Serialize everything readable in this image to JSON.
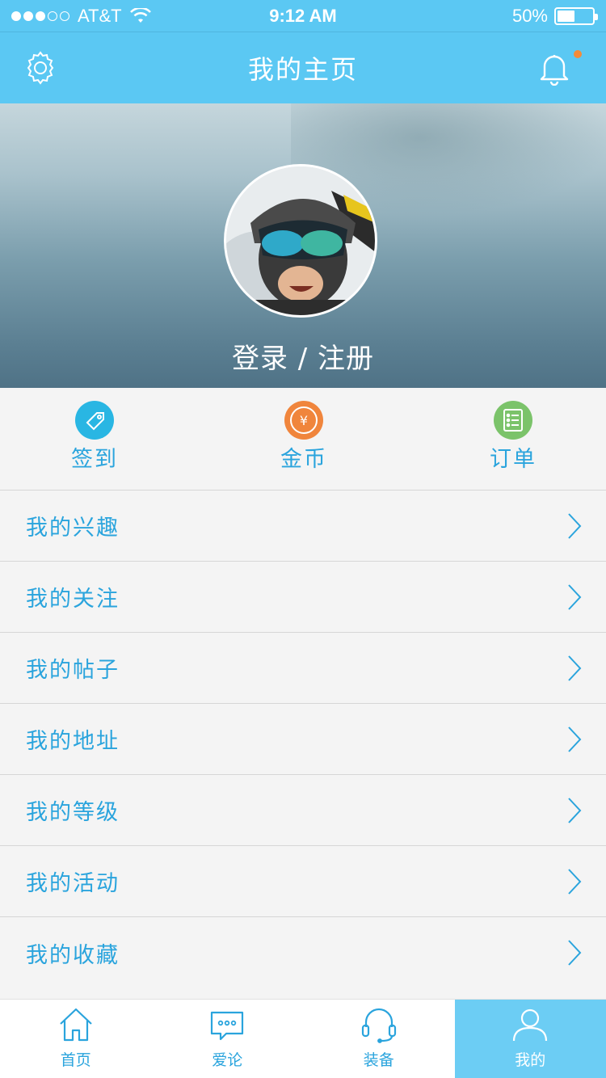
{
  "status_bar": {
    "carrier": "AT&T",
    "time": "9:12 AM",
    "battery_text": "50%",
    "battery_level": 0.5,
    "signal_bars_filled": 3,
    "signal_bars_total": 5
  },
  "nav": {
    "title": "我的主页",
    "settings_icon": "gear-icon",
    "bell_icon": "bell-icon",
    "has_notification": true
  },
  "profile": {
    "login_label": "登录 / 注册",
    "avatar_icon": "avatar"
  },
  "quick_actions": [
    {
      "label": "签到",
      "icon": "tag-icon",
      "color": "#29b6e3"
    },
    {
      "label": "金币",
      "icon": "coin-icon",
      "color": "#f0853c"
    },
    {
      "label": "订单",
      "icon": "list-icon",
      "color": "#7bc36a"
    }
  ],
  "menu": [
    {
      "label": "我的兴趣"
    },
    {
      "label": "我的关注"
    },
    {
      "label": "我的帖子"
    },
    {
      "label": "我的地址"
    },
    {
      "label": "我的等级"
    },
    {
      "label": "我的活动"
    },
    {
      "label": "我的收藏"
    }
  ],
  "tabs": [
    {
      "label": "首页",
      "icon": "home-icon",
      "active": false
    },
    {
      "label": "爱论",
      "icon": "chat-icon",
      "active": false
    },
    {
      "label": "装备",
      "icon": "headset-icon",
      "active": false
    },
    {
      "label": "我的",
      "icon": "user-icon",
      "active": true
    }
  ],
  "colors": {
    "primary": "#5bc8f3",
    "accent_text": "#2aa4dd",
    "notification_dot": "#f58b38",
    "active_tab": "#6ccdf4"
  }
}
